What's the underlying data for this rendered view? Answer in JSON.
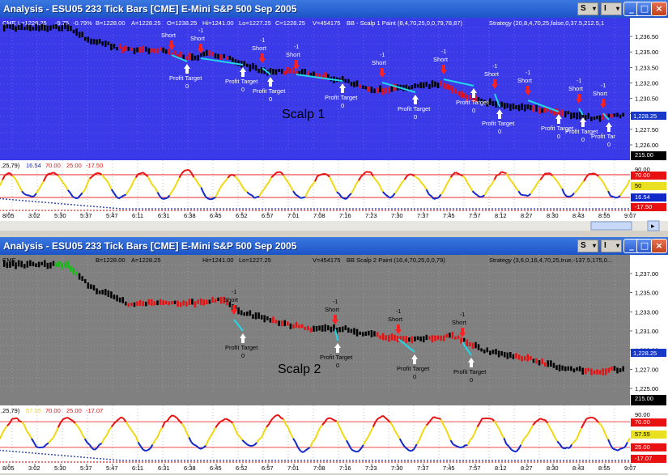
{
  "colors": {
    "panel1_bg": "#3a3ae8",
    "panel2_bg": "#808080",
    "ind_bg": "#ffffff",
    "line_blue": "#0000ff",
    "cyan": "#22d8e8",
    "red": "#ff2020",
    "yellow": "#f8e820"
  },
  "windows": [
    {
      "title": "Analysis - ESU05  233 Tick Bars [CME] E-Mini S&P 500 Sep 2005",
      "buttons": {
        "s": "S",
        "i": "I",
        "min": "_",
        "max": "□",
        "close": "×"
      },
      "header": {
        "exchange": "CME",
        "last": "L=1228.25",
        "chg": "-9.75",
        "pct": "-0.79%",
        "bid": "B=1228.00",
        "ask": "A=1228.25",
        "open": "O=1238.25",
        "hi": "Hi=1241.00",
        "lo": "Lo=1227.25",
        "close": "C=1228.25",
        "vol": "V=454175",
        "study": "BB - Scalp 1 Paint  (8,4,70,25,0,0,79,78,87)",
        "strategy": "Strategy  (20,8,4,70,25,false,0,37.5,212.5,1"
      },
      "caption": "Scalp 1",
      "price_axis": [
        "1,236.50",
        "1,235.00",
        "1,233.50",
        "1,232.00",
        "1,230.50",
        "1,229.00",
        "1,227.50",
        "1,226.00"
      ],
      "last_price_tag": "1,228.25",
      "ind_header": {
        "params": ",25,79)",
        "v1": "16.54",
        "v2": "70.00",
        "v3": "25.00",
        "v4": "-17.50"
      },
      "ind_axis": {
        "a": "215.00",
        "b": "90.00",
        "c": "70.00",
        "d": "50",
        "e": "16.54",
        "f": "-17.50"
      },
      "time_axis": [
        "8/05",
        "3:02",
        "5:30",
        "5:37",
        "5:47",
        "6:11",
        "6:31",
        "6:38",
        "6:45",
        "6:52",
        "6:57",
        "7:01",
        "7:08",
        "7:16",
        "7:23",
        "7:30",
        "7:37",
        "7:45",
        "7:57",
        "8:12",
        "8:27",
        "8:30",
        "8:43",
        "8:55",
        "9:07"
      ],
      "trades": [
        {
          "short": "Short",
          "qty": "",
          "pt": "Profit Target",
          "z": "0"
        },
        {
          "short": "Short",
          "qty": "-1",
          "pt": "Profit Target",
          "z": "0"
        },
        {
          "short": "Short",
          "qty": "-1",
          "pt": "Profit Target",
          "z": "0"
        },
        {
          "short": "Short",
          "qty": "-1",
          "pt": "Profit Target",
          "z": "0"
        },
        {
          "short": "Short",
          "qty": "-1",
          "pt": "Profit Target",
          "z": "0"
        },
        {
          "short": "Short",
          "qty": "-1",
          "pt": "Profit Target",
          "z": "0"
        },
        {
          "short": "Short",
          "qty": "-1",
          "pt": "Profit Target",
          "z": "0"
        },
        {
          "short": "Short",
          "qty": "-1",
          "pt": "Profit Target",
          "z": "0"
        },
        {
          "short": "Short",
          "qty": "-1",
          "pt": "Profit Target",
          "z": "0"
        },
        {
          "short": "Short",
          "qty": "-1",
          "pt": "Profit Tar",
          "z": "0"
        }
      ]
    },
    {
      "title": "Analysis - ESU05  233 Tick Bars [CME] E-Mini S&P 500 Sep 2005",
      "buttons": {
        "s": "S",
        "i": "I",
        "min": "_",
        "max": "□",
        "close": "×"
      },
      "header": {
        "exchange": "CME",
        "last": "",
        "chg": "",
        "pct": "",
        "bid": "B=1228.00",
        "ask": "A=1228.25",
        "open": "",
        "hi": "Hi=1241.00",
        "lo": "Lo=1227.25",
        "close": "",
        "vol": "V=454175",
        "study": "BB Scalp 2 Paint  (16,4,70,25,0,0,79)",
        "strategy": "Strategy  (3,6,0,16,4,70,25,true,-137.5,175,0..."
      },
      "caption": "Scalp 2",
      "price_axis": [
        "1,237.00",
        "1,235.00",
        "1,233.00",
        "1,231.00",
        "1,229.00",
        "1,227.00",
        "1,225.00"
      ],
      "last_price_tag": "1,228.25",
      "ind_header": {
        "params": ",25,79)",
        "v1": "57.55",
        "v2": "70.00",
        "v3": "25.00",
        "v4": "-17.07"
      },
      "ind_axis": {
        "a": "215.00",
        "b": "90.00",
        "c": "70.00",
        "d": "57.55",
        "e": "25.00",
        "f": "-17.07"
      },
      "time_axis": [
        "8/05",
        "3:02",
        "5:30",
        "5:37",
        "5:47",
        "6:11",
        "6:31",
        "6:38",
        "6:45",
        "6:52",
        "6:57",
        "7:01",
        "7:08",
        "7:16",
        "7:23",
        "7:30",
        "7:37",
        "7:45",
        "7:57",
        "8:12",
        "8:27",
        "8:30",
        "8:43",
        "8:55",
        "9:07"
      ],
      "trades": [
        {
          "short": "Short",
          "qty": "-1",
          "pt": "Profit Target",
          "z": "0"
        },
        {
          "short": "Short",
          "qty": "-1",
          "pt": "Profit Target",
          "z": "0"
        },
        {
          "short": "Short",
          "qty": "-1",
          "pt": "Profit Target",
          "z": "0"
        },
        {
          "short": "Short",
          "qty": "-1",
          "pt": "Profit Target",
          "z": "0"
        }
      ]
    }
  ]
}
